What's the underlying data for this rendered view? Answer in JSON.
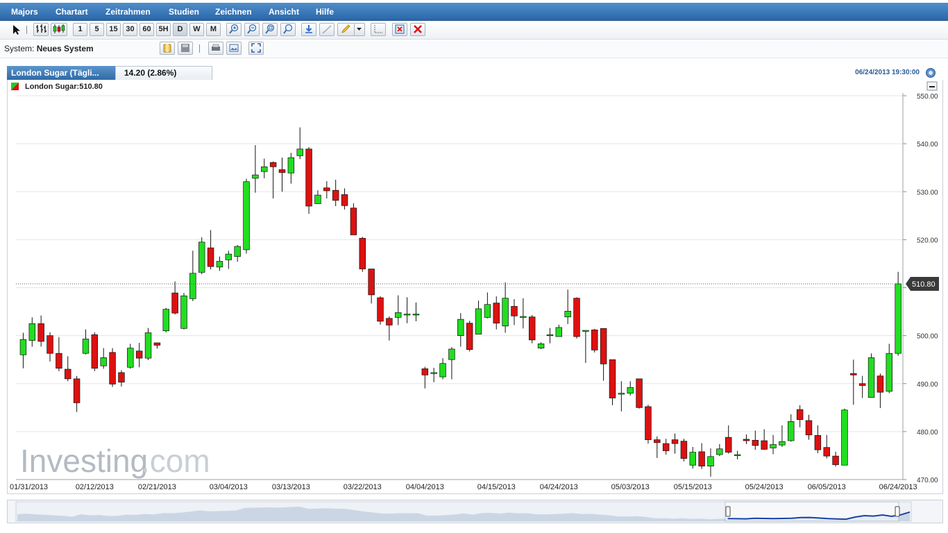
{
  "menu": {
    "items": [
      "Majors",
      "Chartart",
      "Zeitrahmen",
      "Studien",
      "Zeichnen",
      "Ansicht",
      "Hilfe"
    ]
  },
  "toolbar": {
    "timeframes": [
      "1",
      "5",
      "15",
      "30",
      "60",
      "5H",
      "D",
      "W",
      "M"
    ],
    "active_timeframe": "D",
    "icons": [
      "pointer-icon",
      "bar-chart-icon",
      "candlestick-icon",
      "zoom-in-icon",
      "zoom-out-icon",
      "zoom-fit-icon",
      "zoom-reset-icon",
      "download-icon",
      "line-draw-icon",
      "pencil-icon",
      "dropdown-icon",
      "crosshair-icon",
      "delete-drawing-icon",
      "delete-all-icon"
    ]
  },
  "system_bar": {
    "label": "System:",
    "value": "Neues System",
    "icons": [
      "folder-icon",
      "save-icon",
      "print-icon",
      "image-icon",
      "fullscreen-icon"
    ]
  },
  "tab": {
    "title": "London Sugar (Tägli...",
    "price_change": "14.20 (2.86%)",
    "datetime": "06/24/2013 19:30:00"
  },
  "legend": {
    "text": "London Sugar:510.80"
  },
  "colors": {
    "up": "#22dd22",
    "down": "#dd1111",
    "menubar": "#3a7abd",
    "accent": "#2a5c96"
  },
  "watermark": {
    "main": "Investing",
    "suffix": ".com"
  },
  "chart_data": {
    "type": "candlestick",
    "title": "London Sugar (Tägli...",
    "ylim": [
      470,
      550
    ],
    "yticks": [
      "550.00",
      "540.00",
      "530.00",
      "520.00",
      "510.00",
      "500.00",
      "490.00",
      "480.00",
      "470.00"
    ],
    "xticks": [
      "01/31/2013",
      "02/12/2013",
      "02/21/2013",
      "03/04/2013",
      "03/13/2013",
      "03/22/2013",
      "04/04/2013",
      "04/15/2013",
      "04/24/2013",
      "05/03/2013",
      "05/15/2013",
      "05/24/2013",
      "06/05/2013",
      "06/24/2013"
    ],
    "last_price": "510.80",
    "last_value": 510.8,
    "grid": true,
    "candles": [
      [
        496.0,
        499.2,
        493.2,
        500.6
      ],
      [
        499.0,
        502.5,
        497.7,
        503.8
      ],
      [
        502.5,
        498.8,
        497.7,
        504.2
      ],
      [
        500.0,
        496.3,
        494.6,
        500.7
      ],
      [
        496.3,
        493.2,
        492.6,
        499.7
      ],
      [
        493.0,
        491.0,
        490.5,
        495.7
      ],
      [
        491.0,
        486.0,
        484.1,
        491.6
      ],
      [
        496.3,
        499.3,
        496.1,
        501.3
      ],
      [
        500.2,
        493.2,
        492.6,
        500.7
      ],
      [
        493.7,
        495.4,
        493.1,
        497.4
      ],
      [
        496.5,
        489.9,
        489.3,
        497.4
      ],
      [
        492.3,
        490.3,
        489.4,
        492.8
      ],
      [
        493.4,
        497.4,
        493.1,
        498.3
      ],
      [
        496.8,
        495.3,
        493.4,
        498.5
      ],
      [
        495.3,
        500.6,
        494.9,
        501.6
      ],
      [
        498.5,
        498.0,
        497.3,
        498.5
      ],
      [
        501.0,
        505.5,
        500.7,
        505.8
      ],
      [
        508.9,
        504.7,
        504.4,
        511.3
      ],
      [
        501.5,
        508.3,
        501.3,
        508.9
      ],
      [
        507.7,
        513.0,
        507.2,
        517.7
      ],
      [
        513.2,
        519.5,
        512.8,
        520.5
      ],
      [
        518.3,
        514.4,
        513.8,
        522.0
      ],
      [
        514.3,
        515.5,
        513.5,
        516.5
      ],
      [
        515.8,
        517.0,
        513.9,
        517.7
      ],
      [
        516.5,
        518.6,
        515.4,
        518.9
      ],
      [
        517.9,
        532.1,
        517.1,
        532.7
      ],
      [
        532.8,
        533.5,
        529.8,
        539.7
      ],
      [
        534.2,
        535.2,
        532.8,
        536.9
      ],
      [
        536.1,
        535.2,
        528.6,
        536.3
      ],
      [
        534.6,
        534.0,
        530.0,
        537.1
      ],
      [
        533.9,
        537.1,
        531.7,
        538.1
      ],
      [
        537.5,
        538.9,
        536.8,
        543.4
      ],
      [
        538.9,
        527.0,
        525.4,
        539.3
      ],
      [
        527.5,
        529.3,
        527.5,
        530.3
      ],
      [
        530.8,
        530.2,
        528.6,
        532.2
      ],
      [
        530.3,
        528.2,
        527.0,
        532.5
      ],
      [
        529.4,
        527.1,
        526.3,
        530.7
      ],
      [
        526.6,
        521.0,
        521.0,
        527.6
      ],
      [
        520.3,
        513.9,
        513.3,
        520.6
      ],
      [
        513.9,
        508.5,
        506.7,
        513.9
      ],
      [
        507.9,
        503.0,
        502.3,
        508.2
      ],
      [
        503.6,
        502.2,
        499.0,
        504.0
      ],
      [
        503.8,
        504.8,
        502.2,
        508.4
      ],
      [
        504.3,
        504.5,
        502.6,
        508.0
      ],
      [
        504.5,
        504.5,
        503.0,
        506.9
      ],
      [
        493.1,
        491.8,
        489.0,
        493.5
      ],
      [
        492.3,
        492.3,
        490.3,
        493.3
      ],
      [
        491.4,
        494.2,
        490.9,
        495.3
      ],
      [
        495.0,
        497.2,
        490.9,
        497.6
      ],
      [
        500.0,
        503.4,
        497.7,
        504.7
      ],
      [
        502.6,
        497.1,
        496.7,
        503.1
      ],
      [
        500.3,
        505.6,
        500.3,
        507.3
      ],
      [
        503.8,
        506.5,
        503.6,
        509.0
      ],
      [
        506.8,
        502.6,
        501.3,
        508.2
      ],
      [
        502.0,
        507.8,
        500.6,
        511.1
      ],
      [
        506.1,
        504.1,
        502.2,
        507.6
      ],
      [
        504.0,
        504.0,
        501.5,
        507.8
      ],
      [
        503.9,
        499.1,
        498.4,
        504.3
      ],
      [
        497.4,
        498.3,
        497.2,
        498.6
      ],
      [
        500.2,
        500.2,
        498.4,
        501.6
      ],
      [
        499.8,
        501.7,
        499.8,
        502.3
      ],
      [
        503.9,
        505.1,
        502.4,
        509.6
      ],
      [
        507.8,
        499.8,
        499.4,
        508.0
      ],
      [
        501.1,
        501.1,
        494.3,
        501.1
      ],
      [
        501.2,
        497.0,
        496.5,
        501.4
      ],
      [
        501.5,
        494.1,
        490.6,
        501.5
      ],
      [
        495.0,
        487.0,
        485.5,
        495.0
      ],
      [
        488.0,
        488.0,
        484.2,
        490.5
      ],
      [
        488.0,
        489.2,
        487.5,
        490.5
      ],
      [
        491.0,
        485.0,
        484.8,
        491.0
      ],
      [
        485.2,
        478.3,
        477.5,
        485.6
      ],
      [
        478.3,
        477.7,
        474.5,
        479.0
      ],
      [
        477.5,
        476.0,
        475.2,
        478.5
      ],
      [
        478.3,
        477.5,
        475.4,
        479.6
      ],
      [
        478.0,
        474.4,
        473.8,
        478.5
      ],
      [
        473.0,
        475.7,
        472.3,
        476.8
      ],
      [
        475.8,
        472.8,
        472.2,
        477.6
      ],
      [
        472.8,
        474.8,
        470.6,
        476.5
      ],
      [
        475.2,
        476.4,
        474.9,
        477.4
      ],
      [
        478.8,
        475.7,
        475.4,
        481.3
      ],
      [
        475.2,
        475.2,
        474.2,
        476.0
      ],
      [
        478.4,
        478.1,
        477.4,
        479.4
      ],
      [
        478.2,
        477.1,
        476.2,
        480.2
      ],
      [
        478.1,
        476.3,
        476.2,
        480.5
      ],
      [
        476.6,
        477.3,
        475.3,
        479.3
      ],
      [
        477.2,
        477.9,
        476.8,
        481.3
      ],
      [
        478.1,
        482.1,
        477.9,
        483.6
      ],
      [
        484.6,
        482.5,
        480.9,
        485.5
      ],
      [
        482.3,
        479.3,
        478.3,
        483.5
      ],
      [
        479.2,
        476.2,
        475.5,
        481.3
      ],
      [
        476.7,
        474.9,
        474.4,
        479.3
      ],
      [
        474.9,
        473.1,
        472.7,
        475.8
      ],
      [
        473.0,
        484.5,
        473.0,
        484.8
      ],
      [
        492.1,
        491.8,
        485.6,
        495.0
      ],
      [
        490.0,
        489.6,
        487.0,
        491.6
      ],
      [
        487.1,
        495.4,
        487.1,
        496.3
      ],
      [
        491.6,
        488.2,
        484.9,
        492.1
      ],
      [
        488.4,
        496.3,
        488.0,
        498.3
      ],
      [
        496.3,
        510.8,
        495.8,
        513.3
      ]
    ]
  }
}
